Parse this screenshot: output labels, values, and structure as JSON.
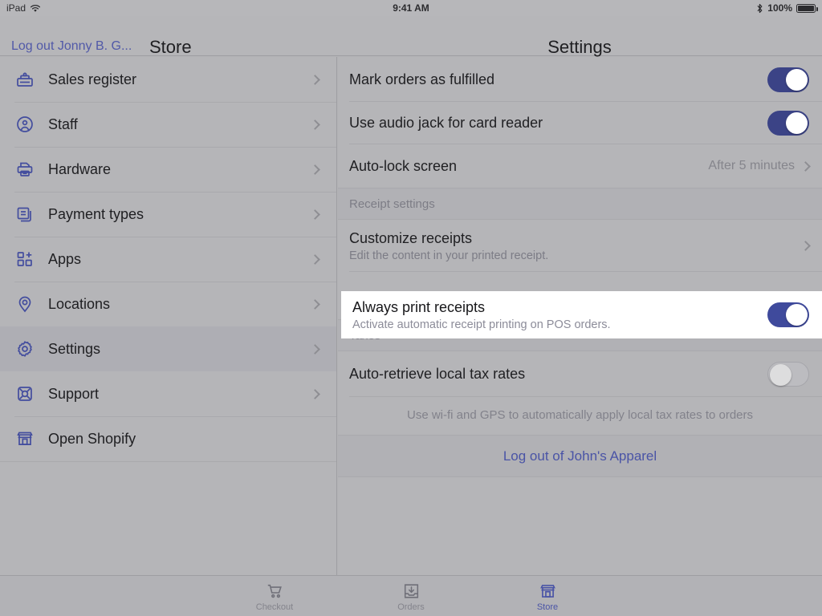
{
  "status_bar": {
    "device": "iPad",
    "wifi_icon": "wifi-icon",
    "time": "9:41 AM",
    "bluetooth_icon": "bluetooth-icon",
    "battery_percent": "100%",
    "battery_icon": "battery-full-icon"
  },
  "header": {
    "logout_user": "Log out Jonny B. G...",
    "store_title": "Store",
    "settings_title": "Settings"
  },
  "sidebar": {
    "items": [
      {
        "label": "Sales register",
        "icon": "cash-register-icon",
        "selected": false
      },
      {
        "label": "Staff",
        "icon": "staff-person-icon",
        "selected": false
      },
      {
        "label": "Hardware",
        "icon": "printer-icon",
        "selected": false
      },
      {
        "label": "Payment types",
        "icon": "payment-cards-icon",
        "selected": false
      },
      {
        "label": "Apps",
        "icon": "apps-grid-plus-icon",
        "selected": false
      },
      {
        "label": "Locations",
        "icon": "map-pin-icon",
        "selected": false
      },
      {
        "label": "Settings",
        "icon": "gear-icon",
        "selected": true
      },
      {
        "label": "Support",
        "icon": "support-lifering-icon",
        "selected": false
      },
      {
        "label": "Open Shopify",
        "icon": "storefront-icon",
        "selected": false
      }
    ]
  },
  "settings": {
    "general_rows": [
      {
        "title": "Mark orders as fulfilled",
        "control": "toggle",
        "value": "on"
      },
      {
        "title": "Use audio jack for card reader",
        "control": "toggle",
        "value": "on"
      },
      {
        "title": "Auto-lock screen",
        "control": "disclosure",
        "value": "After 5 minutes"
      }
    ],
    "receipt_section_header": "Receipt settings",
    "receipt_rows": [
      {
        "title": "Customize receipts",
        "subtitle": "Edit the content in your printed receipt.",
        "control": "disclosure"
      },
      {
        "title": "Always print receipts",
        "subtitle": "Activate automatic receipt printing on POS orders.",
        "control": "toggle",
        "value": "on",
        "highlighted": true
      }
    ],
    "taxes_section_header": "Taxes",
    "taxes_rows": [
      {
        "title": "Auto-retrieve local tax rates",
        "control": "toggle",
        "value": "off"
      }
    ],
    "taxes_footnote": "Use wi-fi and GPS to automatically apply local tax rates to orders",
    "logout_store_label": "Log out of John's Apparel"
  },
  "tab_bar": {
    "tabs": [
      {
        "label": "Checkout",
        "icon": "shopping-cart-icon",
        "active": false
      },
      {
        "label": "Orders",
        "icon": "orders-tray-icon",
        "active": false
      },
      {
        "label": "Store",
        "icon": "storefront-icon",
        "active": true
      }
    ]
  },
  "colors": {
    "accent": "#4a54a6",
    "toggle_on": "#3f4a9c",
    "toggle_off_track": "#bcbcc0",
    "background": "#b5b5b8",
    "spotlight": "#ffffff",
    "text_primary": "#1f1f22",
    "text_secondary": "#7d7d86"
  }
}
